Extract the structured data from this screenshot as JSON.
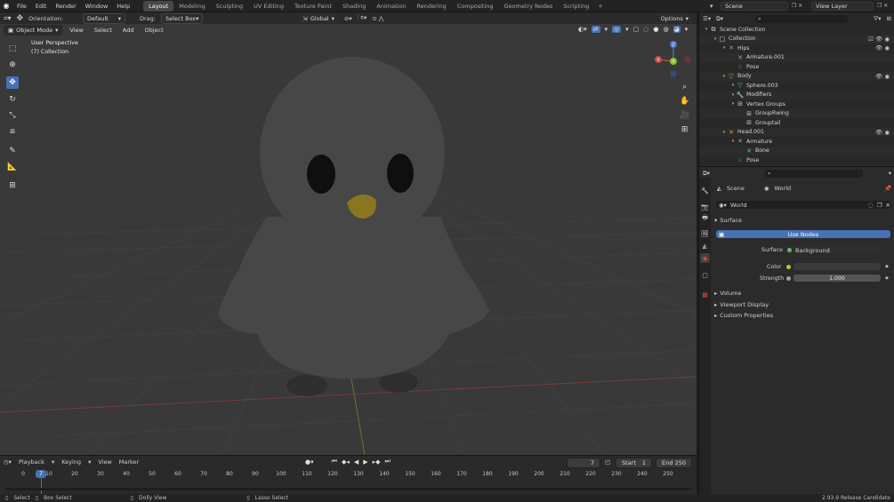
{
  "menubar": {
    "menus": [
      "File",
      "Edit",
      "Render",
      "Window",
      "Help"
    ],
    "workspaces": [
      "Layout",
      "Modeling",
      "Sculpting",
      "UV Editing",
      "Texture Paint",
      "Shading",
      "Animation",
      "Rendering",
      "Compositing",
      "Geometry Nodes",
      "Scripting"
    ],
    "active_workspace": "Layout",
    "scene": "Scene",
    "view_layer": "View Layer"
  },
  "viewport": {
    "orientation_label": "Orientation:",
    "orientation_value": "Default",
    "drag_label": "Drag:",
    "drag_value": "Select Box",
    "transform_space": "Global",
    "options_label": "Options",
    "mode": "Object Mode",
    "menus": [
      "View",
      "Select",
      "Add",
      "Object"
    ],
    "perspective_label": "User Perspective",
    "collection_label": "(7) Collection"
  },
  "timeline": {
    "menus": [
      "Playback",
      "Keying",
      "View",
      "Marker"
    ],
    "current_frame": "7",
    "start_label": "Start",
    "start_value": "1",
    "end_label": "End",
    "end_value": "250",
    "ruler": [
      "0",
      "10",
      "20",
      "30",
      "40",
      "50",
      "60",
      "70",
      "80",
      "90",
      "100",
      "110",
      "120",
      "130",
      "140",
      "150",
      "160",
      "170",
      "180",
      "190",
      "200",
      "210",
      "220",
      "230",
      "240",
      "250"
    ]
  },
  "statusbar": {
    "items": [
      "Select",
      "Box Select",
      "Dolly View",
      "Lasso Select"
    ],
    "version": "2.93.9 Release Candidate"
  },
  "outliner": {
    "rows": [
      {
        "label": "Scene Collection",
        "indent": 0
      },
      {
        "label": "Collection",
        "indent": 1
      },
      {
        "label": "Hips",
        "indent": 2
      },
      {
        "label": "Armature.001",
        "indent": 3
      },
      {
        "label": "Pose",
        "indent": 3
      },
      {
        "label": "Body",
        "indent": 2
      },
      {
        "label": "Sphere.003",
        "indent": 3
      },
      {
        "label": "Modifiers",
        "indent": 3
      },
      {
        "label": "Vertex Groups",
        "indent": 3
      },
      {
        "label": "GroupRwing",
        "indent": 4
      },
      {
        "label": "Grouptail",
        "indent": 4
      },
      {
        "label": "Head.001",
        "indent": 2
      },
      {
        "label": "Armature",
        "indent": 3
      },
      {
        "label": "Bone",
        "indent": 4
      },
      {
        "label": "Pose",
        "indent": 3
      }
    ]
  },
  "properties": {
    "breadcrumb_scene": "Scene",
    "breadcrumb_world": "World",
    "world_name": "World",
    "surface_panel": "Surface",
    "use_nodes": "Use Nodes",
    "surface_label": "Surface",
    "surface_value": "Background",
    "color_label": "Color",
    "strength_label": "Strength",
    "strength_value": "1.000",
    "panels": [
      "Volume",
      "Viewport Display",
      "Custom Properties"
    ]
  },
  "colors": {
    "accent": "#4772b3",
    "viewport_bg": "#393939",
    "mesh": "#474747",
    "beak": "#8a7620"
  }
}
